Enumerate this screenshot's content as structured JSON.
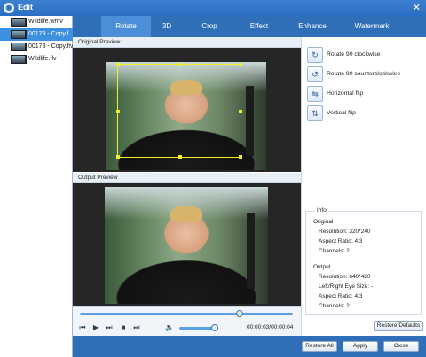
{
  "window": {
    "title": "Edit",
    "close_icon": "close-icon"
  },
  "files": [
    {
      "name": "Wildlife.wmv"
    },
    {
      "name": "00173 - Copy.f"
    },
    {
      "name": "00173 - Copy.flv"
    },
    {
      "name": "Wildlife.flv"
    }
  ],
  "tabs": [
    "Rotate",
    "3D",
    "Crop",
    "Effect",
    "Enhance",
    "Watermark"
  ],
  "preview": {
    "original_label": "Original Preview",
    "output_label": "Output Preview"
  },
  "rotate_actions": [
    {
      "label": "Rotate 90 clockwise",
      "icon": "rotate-clockwise-icon"
    },
    {
      "label": "Rotate 90 counterclockwise",
      "icon": "rotate-counterclockwise-icon"
    },
    {
      "label": "Horizontal flip",
      "icon": "horizontal-flip-icon"
    },
    {
      "label": "Vertical flip",
      "icon": "vertical-flip-icon"
    }
  ],
  "info": {
    "title": "Info",
    "original_heading": "Original",
    "original": [
      "Resolution: 320*240",
      "Aspect Ratio: 4:3",
      "Channels: 2"
    ],
    "output_heading": "Output",
    "output": [
      "Resolution: 640*480",
      "Left/Right Eye Size: -",
      "Aspect Ratio: 4:3",
      "Channels: 2"
    ]
  },
  "playback": {
    "time": "00:00:03/00:00:04",
    "seek_fraction": 0.75,
    "volume_fraction": 0.9
  },
  "buttons": {
    "restore_defaults": "Restore Defaults",
    "restore_all": "Restore All",
    "apply": "Apply",
    "close": "Close"
  },
  "colors": {
    "accent": "#2f6fb8",
    "active_tab": "#4a8fd8",
    "crop_frame": "#f0ee2a",
    "selected_file": "#3d8fe0"
  }
}
